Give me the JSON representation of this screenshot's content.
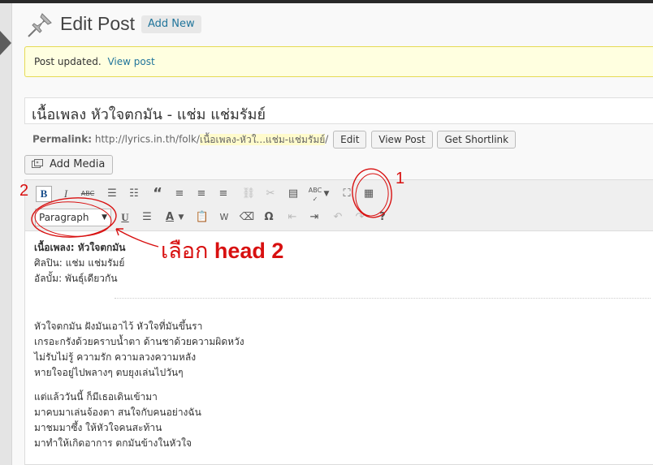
{
  "header": {
    "title": "Edit Post",
    "add_new_label": "Add New"
  },
  "notice": {
    "text": "Post updated.",
    "link": "View post"
  },
  "post": {
    "title": "เนื้อเพลง หัวใจตกมัน - แช่ม แช่มรัมย์"
  },
  "permalink": {
    "label": "Permalink:",
    "base_url": "http://lyrics.in.th/folk/",
    "slug": "เนื้อเพลง-หัวใ...แช่ม-แช่มรัมย์",
    "trailing": "/",
    "edit_label": "Edit",
    "view_post_label": "View Post",
    "shortlink_label": "Get Shortlink"
  },
  "media": {
    "add_media_label": "Add Media"
  },
  "toolbar": {
    "format_value": "Paragraph",
    "row1": [
      "bold-icon",
      "italic-icon",
      "strikethrough-icon",
      "bullet-list-icon",
      "numbered-list-icon",
      "blockquote-icon",
      "align-left-icon",
      "align-center-icon",
      "align-right-icon",
      "link-icon",
      "unlink-icon",
      "more-tag-icon",
      "spellcheck-icon",
      "fullscreen-icon",
      "kitchen-sink-icon"
    ],
    "row2": [
      "format-select",
      "underline-icon",
      "justify-icon",
      "text-color-icon",
      "paste-text-icon",
      "paste-word-icon",
      "clear-formatting-icon",
      "special-character-icon",
      "outdent-icon",
      "indent-icon",
      "undo-icon",
      "redo-icon",
      "help-icon"
    ]
  },
  "content": {
    "header_lines": [
      "เนื้อเพลง: หัวใจตกมัน",
      "ศิลปิน: แช่ม แช่มรัมย์",
      "อัลบั้ม: พันธุ์เดียวกัน"
    ],
    "verse1": [
      "หัวใจตกมัน ฝังมันเอาไว้ หัวใจที่มันขึ้นรา",
      "เกรอะกรังด้วยคราบน้ำตา ด้านชาด้วยความผิดหวัง",
      "ไม่รับไม่รู้ ความรัก ความลวงความหลัง",
      "หายใจอยู่ไปพลางๆ ตบยุงเล่นไปวันๆ"
    ],
    "verse2": [
      "แต่แล้ววันนี้ ก็มีเธอเดินเข้ามา",
      "มาคบมาเล่นจ้องตา สนใจกับคนอย่างฉัน",
      "มาชมมาซึ้ง ให้หัวใจคนสะท้าน",
      "มาทำให้เกิดอาการ ตกมันข้างในหัวใจ"
    ]
  },
  "annotations": {
    "num1": "1",
    "num2": "2",
    "instruction": "เลือก",
    "instruction_bold": "head 2"
  },
  "colors": {
    "accent_link": "#21759b",
    "annotation_red": "#d81010",
    "notice_bg": "#ffffe0"
  }
}
